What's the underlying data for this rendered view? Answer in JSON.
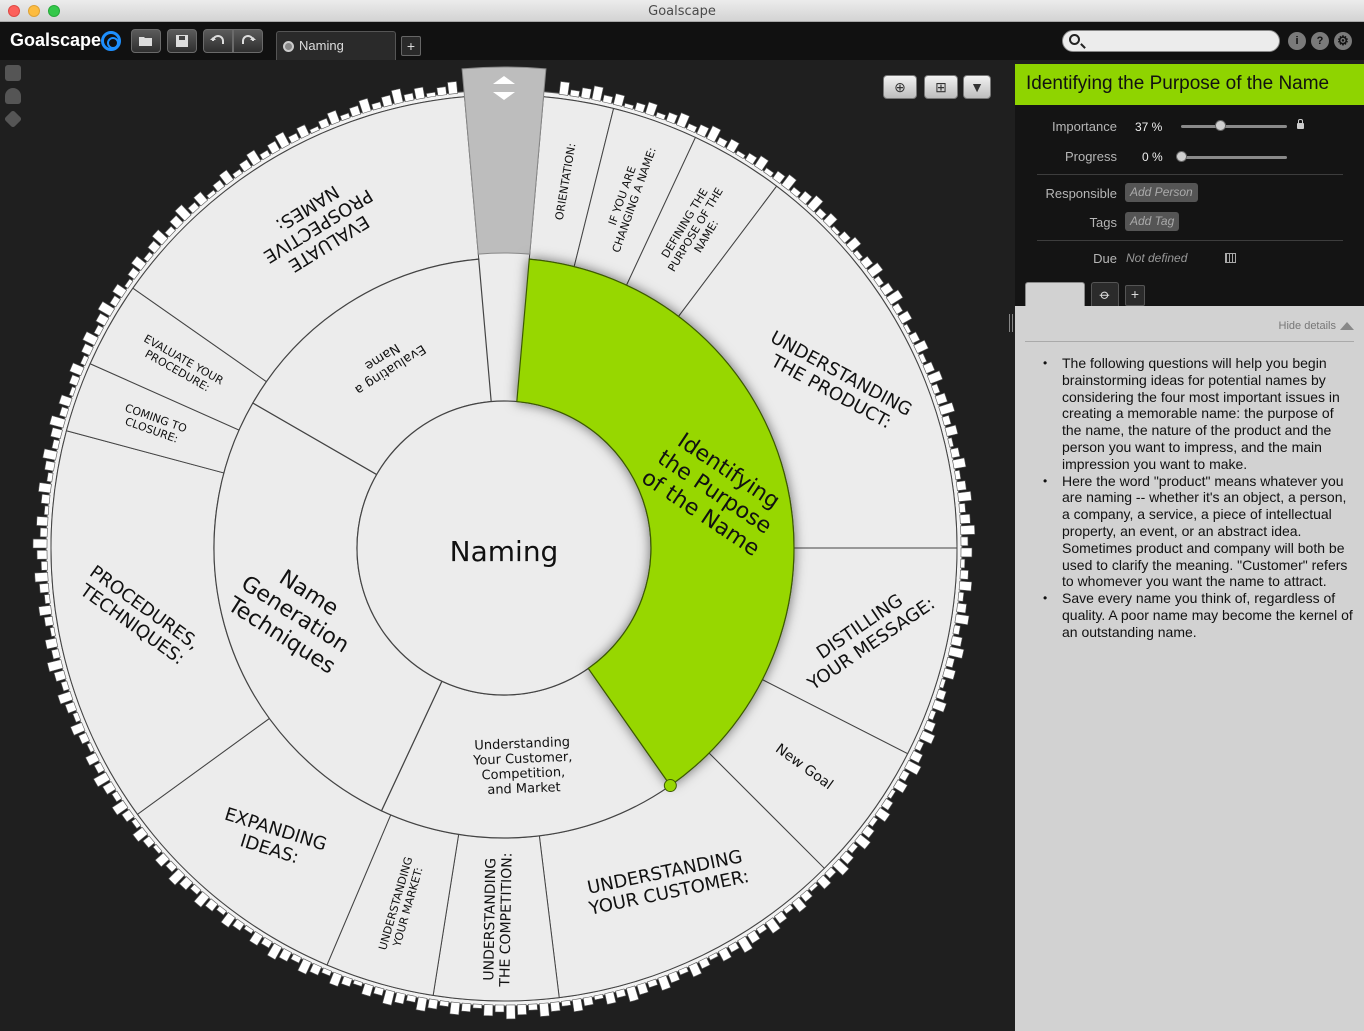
{
  "window": {
    "title": "Goalscape"
  },
  "toolbar": {
    "logo": "Goalscape",
    "open_icon": "folder-open-icon",
    "save_icon": "save-icon",
    "undo_icon": "undo-icon",
    "redo_icon": "redo-icon",
    "tab_label": "Naming",
    "add_tab": "+",
    "search_placeholder": "",
    "info_label": "i",
    "help_label": "?",
    "settings_icon": "gear-icon"
  },
  "left_strip": {
    "icons": [
      "overview-icon",
      "person-icon",
      "tag-icon"
    ]
  },
  "view_buttons": [
    "add-sibling-icon",
    "add-child-icon",
    "dropdown-icon"
  ],
  "wheel": {
    "center": "Naming",
    "inner": [
      {
        "label": "Identifying the Purpose of the Name",
        "start": 5,
        "end": 145,
        "selected": true
      },
      {
        "label": "Understanding Your Customer, Competition, and Market",
        "start": 145,
        "end": 205
      },
      {
        "label": "Name Generation Techniques",
        "start": 205,
        "end": 300
      },
      {
        "label": "Evaluating a Name",
        "start": 300,
        "end": 355
      },
      {
        "label": "",
        "start": 355,
        "end": 365,
        "handle": true
      }
    ],
    "outer": [
      {
        "label": "ORIENTATION:",
        "start": 5,
        "end": 14
      },
      {
        "label": "IF YOU ARE CHANGING A NAME:",
        "start": 14,
        "end": 25
      },
      {
        "label": "DEFINING THE PURPOSE OF THE NAME:",
        "start": 25,
        "end": 37
      },
      {
        "label": "UNDERSTANDING THE PRODUCT:",
        "start": 37,
        "end": 90
      },
      {
        "label": "DISTILLING YOUR MESSAGE:",
        "start": 90,
        "end": 117
      },
      {
        "label": "New Goal",
        "start": 117,
        "end": 135
      },
      {
        "label": "UNDERSTANDING YOUR CUSTOMER:",
        "start": 135,
        "end": 173
      },
      {
        "label": "UNDERSTANDING THE COMPETITION:",
        "start": 173,
        "end": 189
      },
      {
        "label": "UNDERSTANDING YOUR MARKET:",
        "start": 189,
        "end": 203
      },
      {
        "label": "EXPANDING IDEAS:",
        "start": 203,
        "end": 234
      },
      {
        "label": "PROCEDURES, TECHNIQUES:",
        "start": 234,
        "end": 285
      },
      {
        "label": "COMING TO CLOSURE:",
        "start": 285,
        "end": 294
      },
      {
        "label": "EVALUATE YOUR PROCEDURE:",
        "start": 294,
        "end": 305
      },
      {
        "label": "EVALUATE PROSPECTIVE NAMES:",
        "start": 305,
        "end": 355
      }
    ]
  },
  "panel": {
    "title": "Identifying the Purpose of the Name",
    "importance_label": "Importance",
    "importance_value": "37 %",
    "importance_fraction": 0.37,
    "progress_label": "Progress",
    "progress_value": "0 %",
    "progress_fraction": 0,
    "responsible_label": "Responsible",
    "responsible_placeholder": "Add Person",
    "tags_label": "Tags",
    "tags_placeholder": "Add Tag",
    "due_label": "Due",
    "due_value": "Not defined",
    "calendar_icon": "calendar-icon",
    "attach_icon": "paperclip-icon",
    "add_note_tab": "+",
    "hide_details": "Hide details",
    "notes": [
      "The following questions will help you begin brainstorming ideas for potential names by considering the four most important issues in creating a memorable name: the purpose of the name, the nature of the product and the person you want to impress, and the main impression you want to make.",
      "Here the word \"product\" means whatever you are naming -- whether it's an object, a person, a company, a service, a piece of intellectual property, an event, or an abstract idea. Sometimes product and company will both be used to clarify the meaning. \"Customer\" refers to whomever you want the name to attract.",
      "Save every name you think of, regardless of quality. A poor name may become the kernel of an outstanding name."
    ]
  },
  "colors": {
    "accent": "#8fd400",
    "segment": "#ececec",
    "background": "#1f1f1f"
  }
}
